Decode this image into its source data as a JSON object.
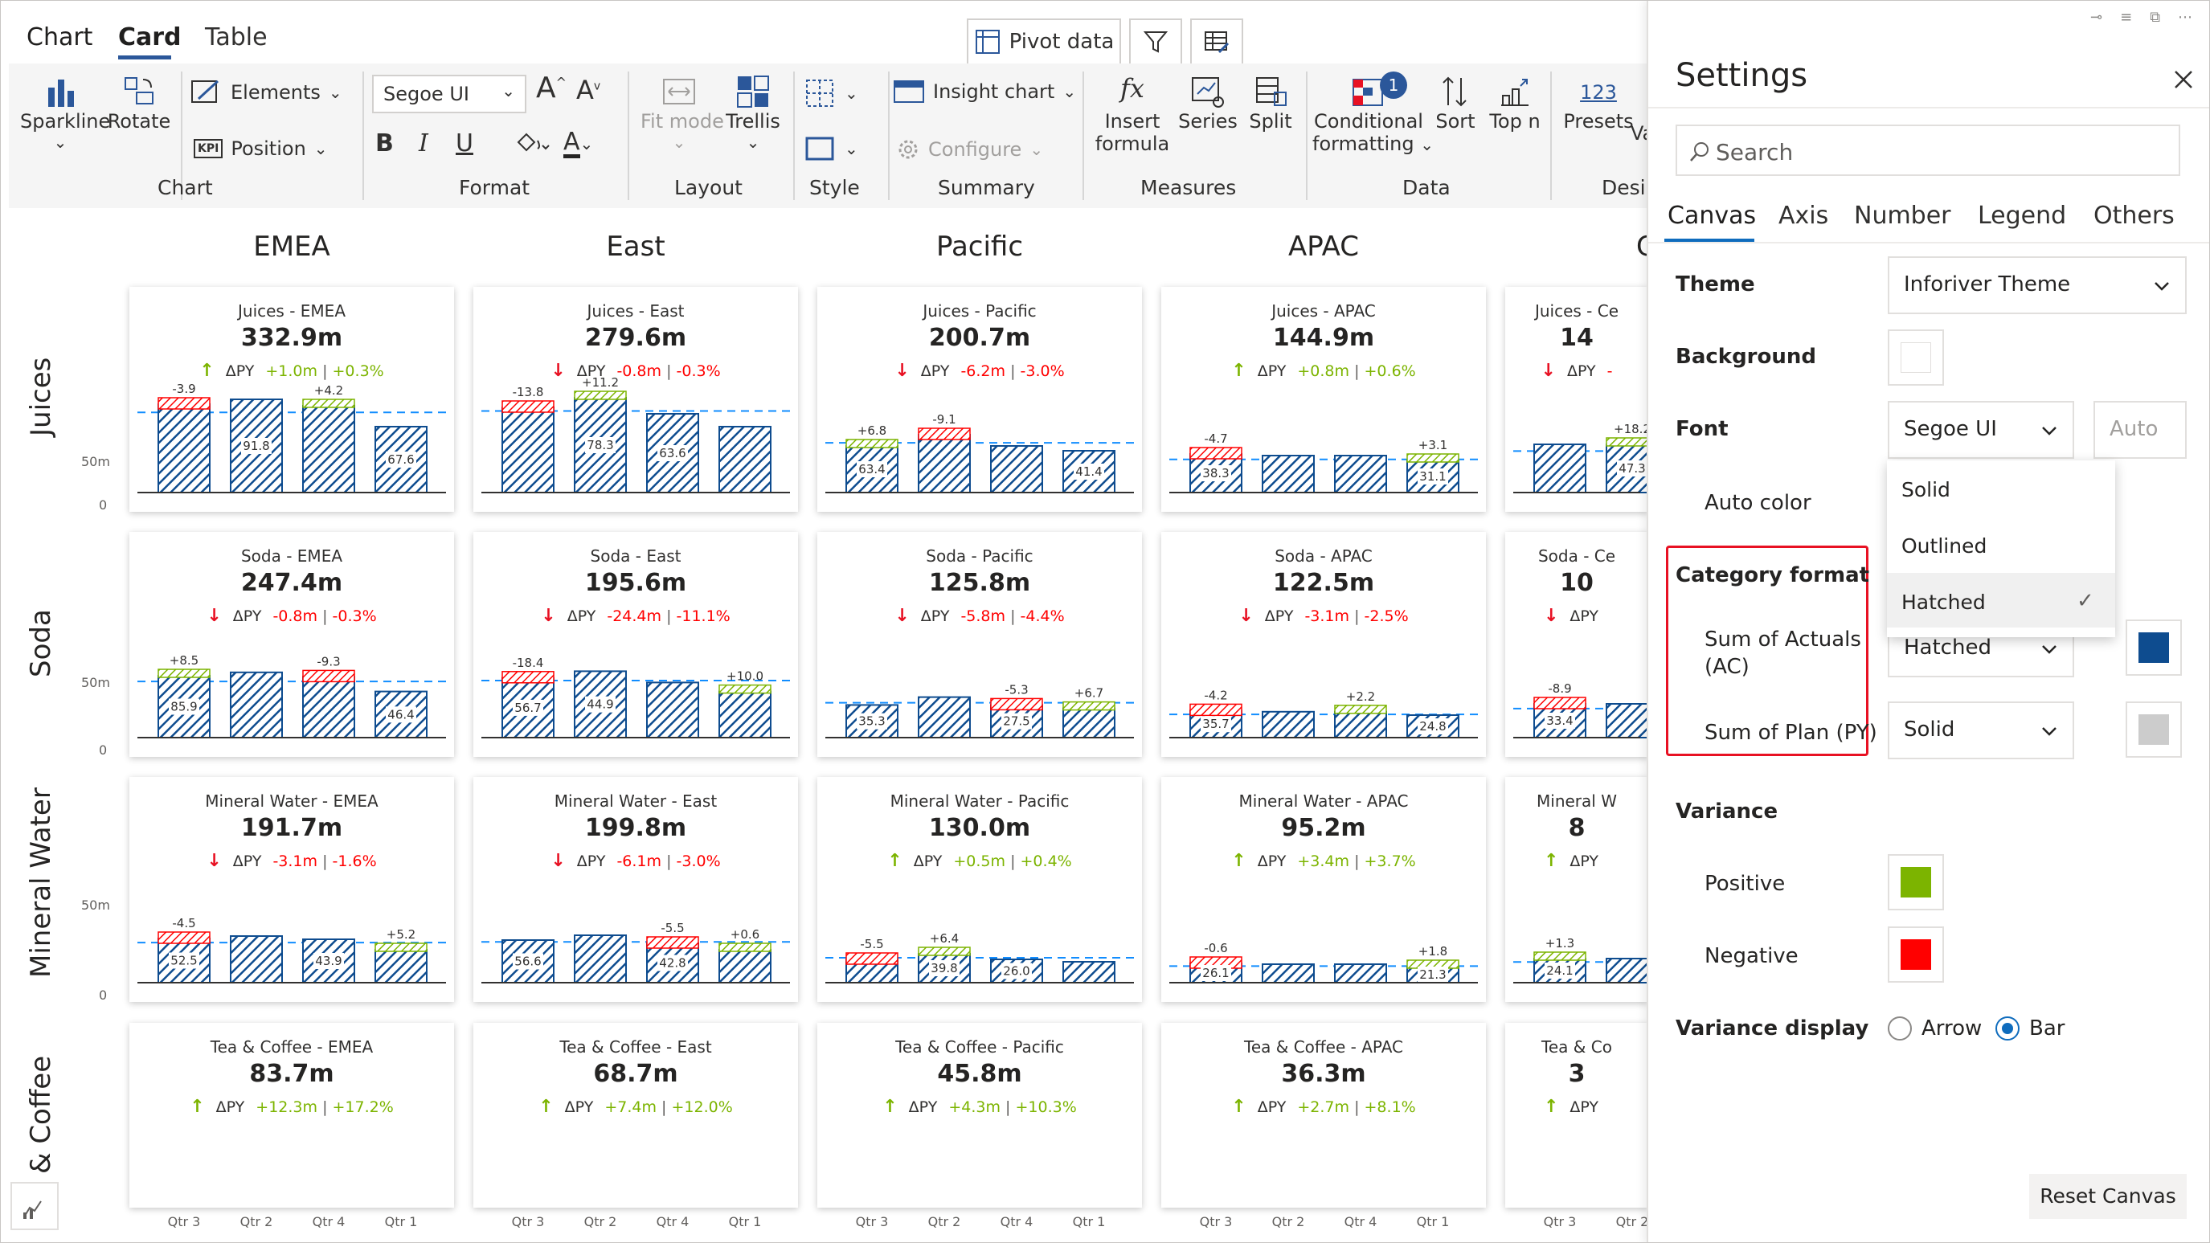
{
  "top_tabs": [
    {
      "label": "Chart"
    },
    {
      "label": "Card"
    },
    {
      "label": "Table"
    }
  ],
  "toolbar": {
    "pivot_data": "Pivot data"
  },
  "ribbon": {
    "groups": [
      "Chart",
      "Format",
      "Layout",
      "Style",
      "Summary",
      "Measures",
      "Data",
      "Desig"
    ],
    "sparkline": "Sparkline",
    "rotate": "Rotate",
    "elements": "Elements",
    "position": "Position",
    "kpi_icon": "KPI",
    "font_name": "Segoe UI",
    "bold": "B",
    "italic": "I",
    "underline": "U",
    "fit_mode": "Fit mode",
    "trellis": "Trellis",
    "insight_chart": "Insight chart",
    "configure": "Configure",
    "insert_formula_1": "Insert",
    "insert_formula_2": "formula",
    "formula_glyph": "fx",
    "series": "Series",
    "split": "Split",
    "cond_format_1": "Conditional",
    "cond_format_2": "formatting",
    "cond_badge": "1",
    "sort": "Sort",
    "top_n": "Top n",
    "presets": "Presets",
    "presets_glyph": "123",
    "va": "Va"
  },
  "regions": [
    "EMEA",
    "East",
    "Pacific",
    "APAC",
    "Ce"
  ],
  "rows": [
    "Juices",
    "Soda",
    "Mineral Water",
    "& Coffee"
  ],
  "axis_labels": {
    "tick_50m": "50m",
    "tick_0": "0"
  },
  "quarters": [
    [
      "Qtr 3",
      "Qtr 2",
      "Qtr 4",
      "Qtr 1"
    ],
    [
      "Qtr 3",
      "Qtr 2",
      "Qtr 4",
      "Qtr 1"
    ],
    [
      "Qtr 3",
      "Qtr 2",
      "Qtr 4",
      "Qtr 1"
    ],
    [
      "Qtr 3",
      "Qtr 2",
      "Qtr 4",
      "Qtr 1"
    ],
    [
      "Qtr 3",
      "Qtr 2"
    ]
  ],
  "cards": [
    [
      {
        "title": "Juices - EMEA",
        "value": "332.9m",
        "dir": "up",
        "dpy": "ΔPY",
        "abs": "+1.0m",
        "pct": "+0.3%",
        "bars": [
          {
            "v": "-3.9",
            "l": ""
          },
          {
            "v": "",
            "l": "91.8"
          },
          {
            "v": "+4.2",
            "l": ""
          },
          {
            "v": "",
            "l": "67.6"
          }
        ]
      },
      {
        "title": "Juices - East",
        "value": "279.6m",
        "dir": "down",
        "dpy": "ΔPY",
        "abs": "-0.8m",
        "pct": "-0.3%",
        "bars": [
          {
            "v": "-13.8",
            "l": ""
          },
          {
            "v": "+11.2",
            "l": "78.3"
          },
          {
            "v": "",
            "l": "63.6"
          },
          {
            "v": "",
            "l": ""
          }
        ]
      },
      {
        "title": "Juices - Pacific",
        "value": "200.7m",
        "dir": "down",
        "dpy": "ΔPY",
        "abs": "-6.2m",
        "pct": "-3.0%",
        "bars": [
          {
            "v": "+6.8",
            "l": "63.4"
          },
          {
            "v": "-9.1",
            "l": ""
          },
          {
            "v": "",
            "l": ""
          },
          {
            "v": "",
            "l": "41.4"
          }
        ]
      },
      {
        "title": "Juices - APAC",
        "value": "144.9m",
        "dir": "up",
        "dpy": "ΔPY",
        "abs": "+0.8m",
        "pct": "+0.6%",
        "bars": [
          {
            "v": "-4.7",
            "l": "38.3"
          },
          {
            "v": "",
            "l": ""
          },
          {
            "v": "",
            "l": ""
          },
          {
            "v": "+3.1",
            "l": "31.1"
          }
        ]
      },
      {
        "title": "Juices - Ce",
        "value": "14",
        "dir": "down",
        "dpy": "ΔPY",
        "abs": "-",
        "pct": "",
        "bars": [
          {
            "v": "",
            "l": ""
          },
          {
            "v": "+18.2",
            "l": "47.3"
          }
        ]
      }
    ],
    [
      {
        "title": "Soda - EMEA",
        "value": "247.4m",
        "dir": "down",
        "dpy": "ΔPY",
        "abs": "-0.8m",
        "pct": "-0.3%",
        "bars": [
          {
            "v": "+8.5",
            "l": "85.9"
          },
          {
            "v": "",
            "l": ""
          },
          {
            "v": "-9.3",
            "l": ""
          },
          {
            "v": "",
            "l": "46.4"
          }
        ]
      },
      {
        "title": "Soda - East",
        "value": "195.6m",
        "dir": "down",
        "dpy": "ΔPY",
        "abs": "-24.4m",
        "pct": "-11.1%",
        "bars": [
          {
            "v": "-18.4",
            "l": "56.7"
          },
          {
            "v": "",
            "l": "44.9"
          },
          {
            "v": "",
            "l": ""
          },
          {
            "v": "+10.0",
            "l": ""
          }
        ]
      },
      {
        "title": "Soda - Pacific",
        "value": "125.8m",
        "dir": "down",
        "dpy": "ΔPY",
        "abs": "-5.8m",
        "pct": "-4.4%",
        "bars": [
          {
            "v": "",
            "l": "35.3"
          },
          {
            "v": "",
            "l": ""
          },
          {
            "v": "-5.3",
            "l": "27.5"
          },
          {
            "v": "+6.7",
            "l": ""
          }
        ]
      },
      {
        "title": "Soda - APAC",
        "value": "122.5m",
        "dir": "down",
        "dpy": "ΔPY",
        "abs": "-3.1m",
        "pct": "-2.5%",
        "bars": [
          {
            "v": "-4.2",
            "l": "35.7"
          },
          {
            "v": "",
            "l": ""
          },
          {
            "v": "+2.2",
            "l": ""
          },
          {
            "v": "",
            "l": "24.8"
          }
        ]
      },
      {
        "title": "Soda - Ce",
        "value": "10",
        "dir": "down",
        "dpy": "ΔPY",
        "abs": "",
        "pct": "",
        "bars": [
          {
            "v": "-8.9",
            "l": "33.4"
          },
          {
            "v": "",
            "l": ""
          }
        ]
      }
    ],
    [
      {
        "title": "Mineral Water - EMEA",
        "value": "191.7m",
        "dir": "down",
        "dpy": "ΔPY",
        "abs": "-3.1m",
        "pct": "-1.6%",
        "bars": [
          {
            "v": "-4.5",
            "l": "52.5"
          },
          {
            "v": "",
            "l": ""
          },
          {
            "v": "",
            "l": "43.9"
          },
          {
            "v": "+5.2",
            "l": ""
          }
        ]
      },
      {
        "title": "Mineral Water - East",
        "value": "199.8m",
        "dir": "down",
        "dpy": "ΔPY",
        "abs": "-6.1m",
        "pct": "-3.0%",
        "bars": [
          {
            "v": "",
            "l": "56.6"
          },
          {
            "v": "",
            "l": ""
          },
          {
            "v": "-5.5",
            "l": "42.8"
          },
          {
            "v": "+0.6",
            "l": ""
          }
        ]
      },
      {
        "title": "Mineral Water - Pacific",
        "value": "130.0m",
        "dir": "up",
        "dpy": "ΔPY",
        "abs": "+0.5m",
        "pct": "+0.4%",
        "bars": [
          {
            "v": "-5.5",
            "l": ""
          },
          {
            "v": "+6.4",
            "l": "39.8"
          },
          {
            "v": "",
            "l": "26.0"
          },
          {
            "v": "",
            "l": ""
          }
        ]
      },
      {
        "title": "Mineral Water - APAC",
        "value": "95.2m",
        "dir": "up",
        "dpy": "ΔPY",
        "abs": "+3.4m",
        "pct": "+3.7%",
        "bars": [
          {
            "v": "-0.6",
            "l": "26.1"
          },
          {
            "v": "",
            "l": ""
          },
          {
            "v": "",
            "l": ""
          },
          {
            "v": "+1.8",
            "l": "21.3"
          }
        ]
      },
      {
        "title": "Mineral W",
        "value": "8",
        "dir": "up",
        "dpy": "ΔPY",
        "abs": "",
        "pct": "",
        "bars": [
          {
            "v": "+1.3",
            "l": "24.1"
          },
          {
            "v": "",
            "l": ""
          }
        ]
      }
    ],
    [
      {
        "title": "Tea & Coffee - EMEA",
        "value": "83.7m",
        "dir": "up",
        "dpy": "ΔPY",
        "abs": "+12.3m",
        "pct": "+17.2%",
        "bars": []
      },
      {
        "title": "Tea & Coffee - East",
        "value": "68.7m",
        "dir": "up",
        "dpy": "ΔPY",
        "abs": "+7.4m",
        "pct": "+12.0%",
        "bars": []
      },
      {
        "title": "Tea & Coffee - Pacific",
        "value": "45.8m",
        "dir": "up",
        "dpy": "ΔPY",
        "abs": "+4.3m",
        "pct": "+10.3%",
        "bars": []
      },
      {
        "title": "Tea & Coffee - APAC",
        "value": "36.3m",
        "dir": "up",
        "dpy": "ΔPY",
        "abs": "+2.7m",
        "pct": "+8.1%",
        "bars": []
      },
      {
        "title": "Tea & Co",
        "value": "3",
        "dir": "up",
        "dpy": "ΔPY",
        "abs": "",
        "pct": "",
        "bars": []
      }
    ]
  ],
  "settings": {
    "title": "Settings",
    "search_placeholder": "Search",
    "tabs": [
      "Canvas",
      "Axis",
      "Number",
      "Legend",
      "Others"
    ],
    "theme_label": "Theme",
    "theme_value": "Inforiver Theme",
    "background_label": "Background",
    "font_label": "Font",
    "font_value": "Segoe UI",
    "font_size_placeholder": "Auto",
    "auto_color_label": "Auto color",
    "category_format_label": "Category format",
    "sum_actuals_1": "Sum of Actuals",
    "sum_actuals_2": "(AC)",
    "sum_actuals_value": "Hatched",
    "sum_plan_label": "Sum of Plan (PY)",
    "sum_plan_value": "Solid",
    "menu_options": [
      "Solid",
      "Outlined",
      "Hatched"
    ],
    "menu_check": "✓",
    "variance_label": "Variance",
    "positive_label": "Positive",
    "negative_label": "Negative",
    "variance_display_label": "Variance display",
    "arrow_label": "Arrow",
    "bar_label": "Bar",
    "reset_label": "Reset Canvas"
  },
  "colors": {
    "accent": "#0f6cbd",
    "actual": "#0e4c8f",
    "plan": "#cccccc",
    "positive": "#7cb400",
    "negative": "#ff0000",
    "down_arrow": "#e81123",
    "up_arrow": "#7cb400",
    "highlight": "#e81123",
    "dashed": "#118dff"
  }
}
